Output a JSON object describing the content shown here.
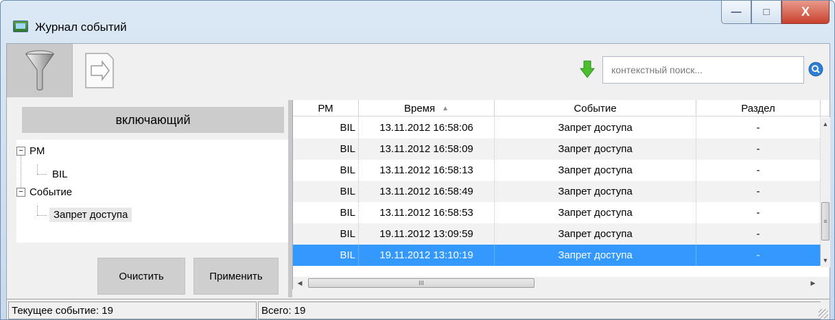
{
  "window": {
    "title": "Журнал событий",
    "controls": {
      "minimize": "—",
      "maximize": "□",
      "close": "X"
    }
  },
  "toolbar": {
    "filter_icon": "funnel-icon",
    "export_icon": "export-document-icon",
    "download_icon": "green-down-arrow-icon",
    "search_placeholder": "контекстный поиск...",
    "search_icon": "search-icon"
  },
  "filter_panel": {
    "mode": "включающий",
    "tree": [
      {
        "label": "РМ",
        "children": [
          "BIL"
        ]
      },
      {
        "label": "Событие",
        "children": [
          "Запрет доступа"
        ]
      }
    ],
    "clear_label": "Очистить",
    "apply_label": "Применить"
  },
  "grid": {
    "columns": [
      "РМ",
      "Время",
      "Событие",
      "Раздел"
    ],
    "sort_column": "Время",
    "rows": [
      {
        "pm": "BIL",
        "time": "13.11.2012 16:58:06",
        "event": "Запрет доступа",
        "section": "-"
      },
      {
        "pm": "BIL",
        "time": "13.11.2012 16:58:09",
        "event": "Запрет доступа",
        "section": "-"
      },
      {
        "pm": "BIL",
        "time": "13.11.2012 16:58:13",
        "event": "Запрет доступа",
        "section": "-"
      },
      {
        "pm": "BIL",
        "time": "13.11.2012 16:58:49",
        "event": "Запрет доступа",
        "section": "-"
      },
      {
        "pm": "BIL",
        "time": "13.11.2012 16:58:53",
        "event": "Запрет доступа",
        "section": "-"
      },
      {
        "pm": "BIL",
        "time": "19.11.2012 13:09:59",
        "event": "Запрет доступа",
        "section": "-"
      },
      {
        "pm": "BIL",
        "time": "19.11.2012 13:10:19",
        "event": "Запрет доступа",
        "section": "-"
      }
    ],
    "selected_row": 6
  },
  "status": {
    "current": "Текущее событие: 19",
    "total": "Всего: 19"
  },
  "colors": {
    "selection": "#3399ff",
    "alt_row": "#f2f2f2",
    "close_button": "#c8412c"
  }
}
